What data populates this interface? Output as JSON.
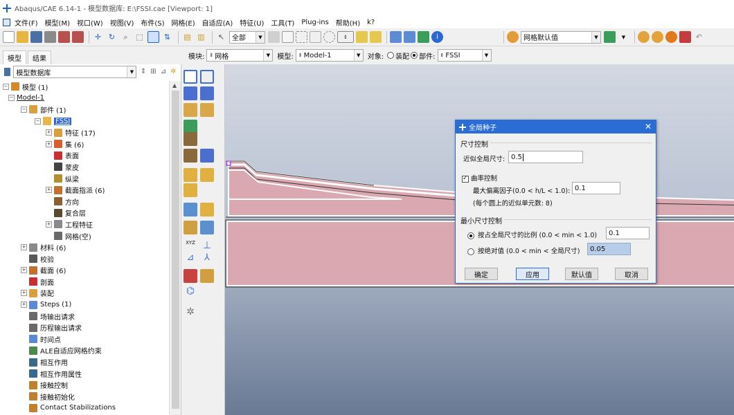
{
  "window": {
    "title": "Abaqus/CAE 6.14-1 - 模型数据库: E:\\FSSI.cae [Viewport: 1]"
  },
  "menubar": {
    "items": [
      "文件(F)",
      "模型(M)",
      "视口(W)",
      "视图(V)",
      "布件(S)",
      "网格(E)",
      "自适应(A)",
      "特征(U)",
      "工具(T)",
      "Plug-ins",
      "帮助(H)",
      "k?"
    ]
  },
  "toolbar": {
    "filter_value": "全部",
    "mesh_defaults_value": "网格默认值"
  },
  "tabs": [
    "模型",
    "结果"
  ],
  "context": {
    "module_label": "模块:",
    "module_value": "网格",
    "model_label": "模型:",
    "model_value": "Model-1",
    "object_label": "对象:",
    "assembly_label": "装配",
    "part_label": "部件:",
    "part_value": "FSSI"
  },
  "tree_header": {
    "value": "模型数据库"
  },
  "tree": [
    {
      "label": "模型 (1)",
      "exp": "minus",
      "icon": "models-icon"
    },
    {
      "label": "Model-1",
      "exp": "minus",
      "icon": "none",
      "underline": true
    },
    {
      "label": "部件 (1)",
      "exp": "minus",
      "icon": "parts-icon"
    },
    {
      "label": "FSSI",
      "exp": "minus",
      "icon": "part-icon",
      "selected": true
    },
    {
      "label": "特征 (17)",
      "exp": "plus",
      "icon": "features-icon"
    },
    {
      "label": "集 (6)",
      "exp": "plus",
      "icon": "sets-icon"
    },
    {
      "label": "表面",
      "exp": "none",
      "icon": "surface-icon"
    },
    {
      "label": "蒙皮",
      "exp": "none",
      "icon": "skin-icon"
    },
    {
      "label": "纵梁",
      "exp": "none",
      "icon": "stringer-icon"
    },
    {
      "label": "截面指派 (6)",
      "exp": "plus",
      "icon": "section-assign-icon"
    },
    {
      "label": "方向",
      "exp": "none",
      "icon": "orientation-icon"
    },
    {
      "label": "复合层",
      "exp": "none",
      "icon": "composite-icon"
    },
    {
      "label": "工程特征",
      "exp": "plus",
      "icon": "engineering-icon"
    },
    {
      "label": "网格(空)",
      "exp": "none",
      "icon": "mesh-icon"
    },
    {
      "label": "材料 (6)",
      "exp": "plus",
      "icon": "materials-icon"
    },
    {
      "label": "校验",
      "exp": "none",
      "icon": "calibration-icon"
    },
    {
      "label": "截面 (6)",
      "exp": "plus",
      "icon": "sections-icon"
    },
    {
      "label": "剖面",
      "exp": "none",
      "icon": "profiles-icon"
    },
    {
      "label": "装配",
      "exp": "plus",
      "icon": "assembly-icon"
    },
    {
      "label": "Steps (1)",
      "exp": "plus",
      "icon": "steps-icon"
    },
    {
      "label": "场输出请求",
      "exp": "none",
      "icon": "field-output-icon"
    },
    {
      "label": "历程输出请求",
      "exp": "none",
      "icon": "history-output-icon"
    },
    {
      "label": "时间点",
      "exp": "none",
      "icon": "time-points-icon"
    },
    {
      "label": "ALE自适应网格约束",
      "exp": "none",
      "icon": "ale-icon"
    },
    {
      "label": "相互作用",
      "exp": "none",
      "icon": "interactions-icon"
    },
    {
      "label": "相互作用属性",
      "exp": "none",
      "icon": "interaction-props-icon"
    },
    {
      "label": "接触控制",
      "exp": "none",
      "icon": "contact-controls-icon"
    },
    {
      "label": "接触初始化",
      "exp": "none",
      "icon": "contact-init-icon"
    },
    {
      "label": "Contact Stabilizations",
      "exp": "none",
      "icon": "contact-stab-icon"
    }
  ],
  "dialog": {
    "title": "全局种子",
    "size_group": "尺寸控制",
    "approx_size_label": "近似全局尺寸:",
    "approx_size_value": "0.5",
    "curvature_label": "曲率控制",
    "max_dev_label": "最大偏离因子(0.0 < h/L < 1.0):",
    "max_dev_value": "0.1",
    "approx_elements_note": "(每个圆上的近似单元数: 8)",
    "min_size_group": "最小尺寸控制",
    "by_fraction_label": "按占全局尺寸的比例  (0.0 < min < 1.0)",
    "by_fraction_value": "0.1",
    "by_absolute_label": "按绝对值  (0.0 < min < 全局尺寸)",
    "by_absolute_value": "0.05",
    "ok": "确定",
    "apply": "应用",
    "defaults": "默认值",
    "cancel": "取消"
  },
  "colors": {
    "soil": "#d9a8b1",
    "dialog_title": "#2a6ed5",
    "viewport_top": "#d3d8e2",
    "viewport_bottom": "#6a7a95",
    "selection": "#2d67d0"
  }
}
